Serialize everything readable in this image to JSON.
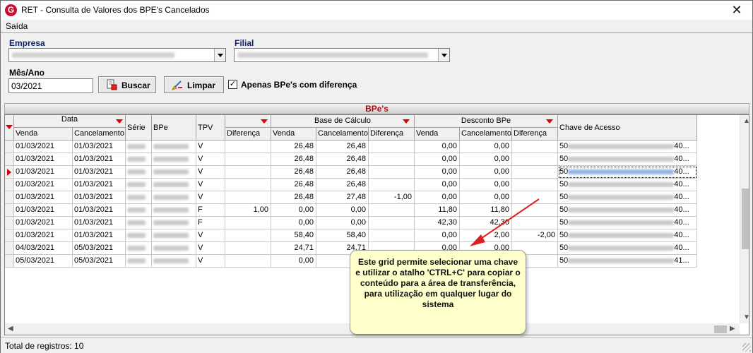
{
  "window": {
    "title": "RET - Consulta de Valores dos BPE's Cancelados",
    "close_symbol": "✕",
    "app_icon": "G"
  },
  "menu": {
    "items": [
      "Saída"
    ]
  },
  "filters": {
    "empresa_label": "Empresa",
    "filial_label": "Filial",
    "mes_ano_label": "Mês/Ano",
    "mes_ano_value": "03/2021",
    "buscar_label": "Buscar",
    "limpar_label": "Limpar",
    "apenas_label": "Apenas BPe's com diferença",
    "apenas_checked": true
  },
  "grid": {
    "title": "BPe's",
    "group_headers": {
      "data": "Data",
      "base": "Base de Cálculo",
      "desconto": "Desconto BPe"
    },
    "columns": {
      "venda": "Venda",
      "cancelamento": "Cancelamento",
      "serie": "Série",
      "bpe": "BPe",
      "tpv": "TPV",
      "diferenca": "Diferença",
      "base_venda": "Venda",
      "base_cancelamento": "Cancelamento",
      "base_diferenca": "Diferença",
      "desc_venda": "Venda",
      "desc_cancelamento": "Cancelamento",
      "desc_diferenca": "Diferença",
      "chave": "Chave de Acesso"
    },
    "rows": [
      {
        "venda": "01/03/2021",
        "cancelamento": "01/03/2021",
        "tpv": "V",
        "diferenca": "",
        "base_venda": "26,48",
        "base_cancelamento": "26,48",
        "base_diferenca": "",
        "desc_venda": "0,00",
        "desc_cancelamento": "0,00",
        "desc_diferenca": "",
        "chave_start": "50",
        "chave_end": "40..."
      },
      {
        "venda": "01/03/2021",
        "cancelamento": "01/03/2021",
        "tpv": "V",
        "diferenca": "",
        "base_venda": "26,48",
        "base_cancelamento": "26,48",
        "base_diferenca": "",
        "desc_venda": "0,00",
        "desc_cancelamento": "0,00",
        "desc_diferenca": "",
        "chave_start": "50",
        "chave_end": "40..."
      },
      {
        "venda": "01/03/2021",
        "cancelamento": "01/03/2021",
        "tpv": "V",
        "diferenca": "",
        "base_venda": "26,48",
        "base_cancelamento": "26,48",
        "base_diferenca": "",
        "desc_venda": "0,00",
        "desc_cancelamento": "0,00",
        "desc_diferenca": "",
        "chave_start": "50",
        "chave_end": "40..."
      },
      {
        "venda": "01/03/2021",
        "cancelamento": "01/03/2021",
        "tpv": "V",
        "diferenca": "",
        "base_venda": "26,48",
        "base_cancelamento": "26,48",
        "base_diferenca": "",
        "desc_venda": "0,00",
        "desc_cancelamento": "0,00",
        "desc_diferenca": "",
        "chave_start": "50",
        "chave_end": "40..."
      },
      {
        "venda": "01/03/2021",
        "cancelamento": "01/03/2021",
        "tpv": "V",
        "diferenca": "",
        "base_venda": "26,48",
        "base_cancelamento": "27,48",
        "base_diferenca": "-1,00",
        "desc_venda": "0,00",
        "desc_cancelamento": "0,00",
        "desc_diferenca": "",
        "chave_start": "50",
        "chave_end": "40..."
      },
      {
        "venda": "01/03/2021",
        "cancelamento": "01/03/2021",
        "tpv": "F",
        "diferenca": "1,00",
        "base_venda": "0,00",
        "base_cancelamento": "0,00",
        "base_diferenca": "",
        "desc_venda": "11,80",
        "desc_cancelamento": "11,80",
        "desc_diferenca": "",
        "chave_start": "50",
        "chave_end": "40..."
      },
      {
        "venda": "01/03/2021",
        "cancelamento": "01/03/2021",
        "tpv": "F",
        "diferenca": "",
        "base_venda": "0,00",
        "base_cancelamento": "0,00",
        "base_diferenca": "",
        "desc_venda": "42,30",
        "desc_cancelamento": "42,30",
        "desc_diferenca": "",
        "chave_start": "50",
        "chave_end": "40..."
      },
      {
        "venda": "01/03/2021",
        "cancelamento": "01/03/2021",
        "tpv": "V",
        "diferenca": "",
        "base_venda": "58,40",
        "base_cancelamento": "58,40",
        "base_diferenca": "",
        "desc_venda": "0,00",
        "desc_cancelamento": "2,00",
        "desc_diferenca": "-2,00",
        "chave_start": "50",
        "chave_end": "40..."
      },
      {
        "venda": "04/03/2021",
        "cancelamento": "05/03/2021",
        "tpv": "V",
        "diferenca": "",
        "base_venda": "24,71",
        "base_cancelamento": "24,71",
        "base_diferenca": "",
        "desc_venda": "0,00",
        "desc_cancelamento": "0,00",
        "desc_diferenca": "",
        "chave_start": "50",
        "chave_end": "40..."
      },
      {
        "venda": "05/03/2021",
        "cancelamento": "05/03/2021",
        "tpv": "V",
        "diferenca": "",
        "base_venda": "0,00",
        "base_cancelamento": "",
        "base_diferenca": "",
        "desc_venda": "",
        "desc_cancelamento": "",
        "desc_diferenca": "",
        "chave_start": "50",
        "chave_end": "41..."
      }
    ],
    "selected_row": 2
  },
  "tooltip": {
    "text": "Este grid permite selecionar uma chave e utilizar o atalho 'CTRL+C' para copiar o conteúdo para a área de transferência, para utilização em qualquer lugar do sistema"
  },
  "status": {
    "text": "Total de registros: 10"
  },
  "colors": {
    "accent_red": "#c00000",
    "tooltip_bg": "#ffffcc",
    "header_title": "#a50f0f"
  }
}
